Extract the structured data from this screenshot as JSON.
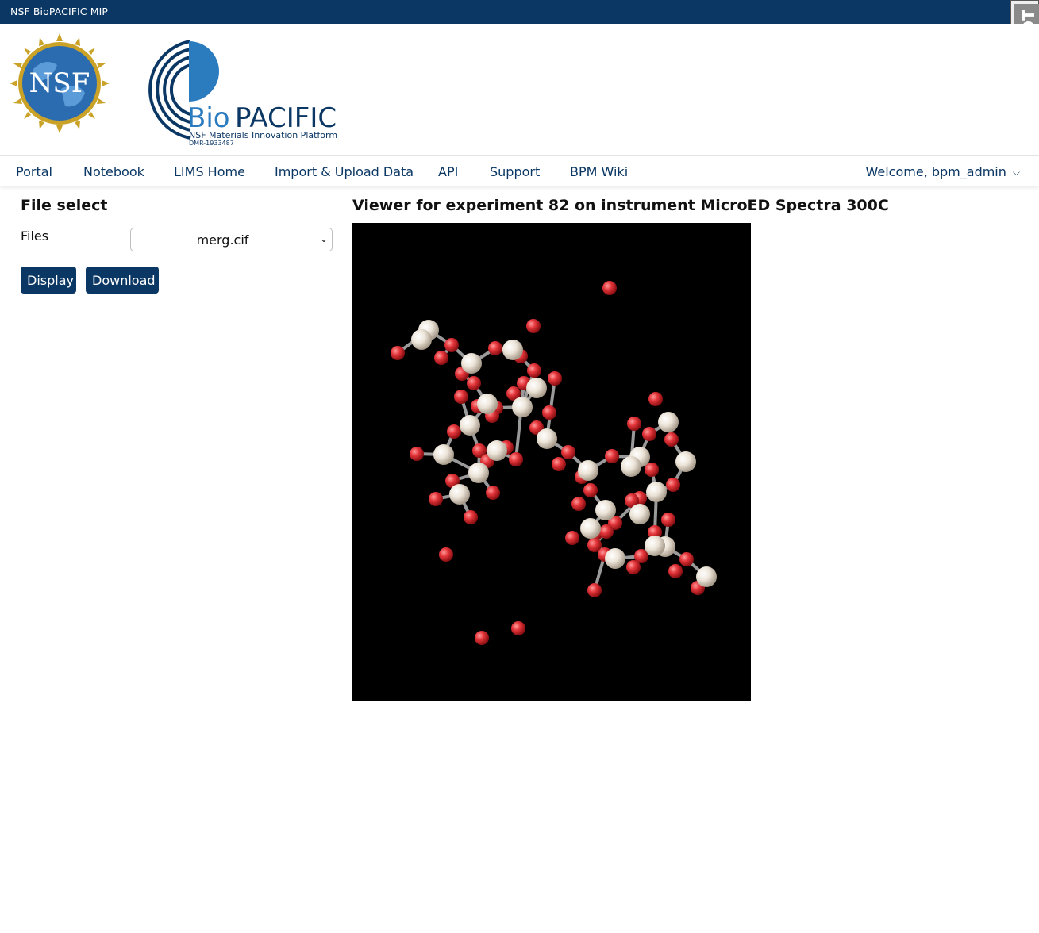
{
  "topbar": {
    "brand": "NSF BioPACIFIC MIP"
  },
  "debug_toolbar": {
    "label_d": "D",
    "label_j": "j",
    "label_dt": "DT"
  },
  "header": {
    "nsf_logo_text": "NSF",
    "bp_logo": {
      "bio": "Bio",
      "pacific": "PACIFIC",
      "subtitle": "NSF Materials Innovation Platform",
      "award": "DMR-1933487"
    }
  },
  "nav": {
    "items": [
      {
        "label": "Portal"
      },
      {
        "label": "Notebook"
      },
      {
        "label": "LIMS Home"
      },
      {
        "label": "Import & Upload Data"
      },
      {
        "label": "API"
      },
      {
        "label": "Support"
      },
      {
        "label": "BPM Wiki"
      }
    ],
    "welcome": "Welcome, bpm_admin"
  },
  "file_select": {
    "title": "File select",
    "files_label": "Files",
    "selected_file": "merg.cif",
    "display_label": "Display",
    "download_label": "Download"
  },
  "viewer": {
    "title": "Viewer for experiment 82 on instrument MicroED Spectra 300C",
    "background": "#000000",
    "atom_colors": {
      "oxygen": "#e3353a",
      "light": "#ece4d8",
      "bond": "#9a9a9a"
    }
  },
  "colors": {
    "primary": "#0b3764"
  }
}
